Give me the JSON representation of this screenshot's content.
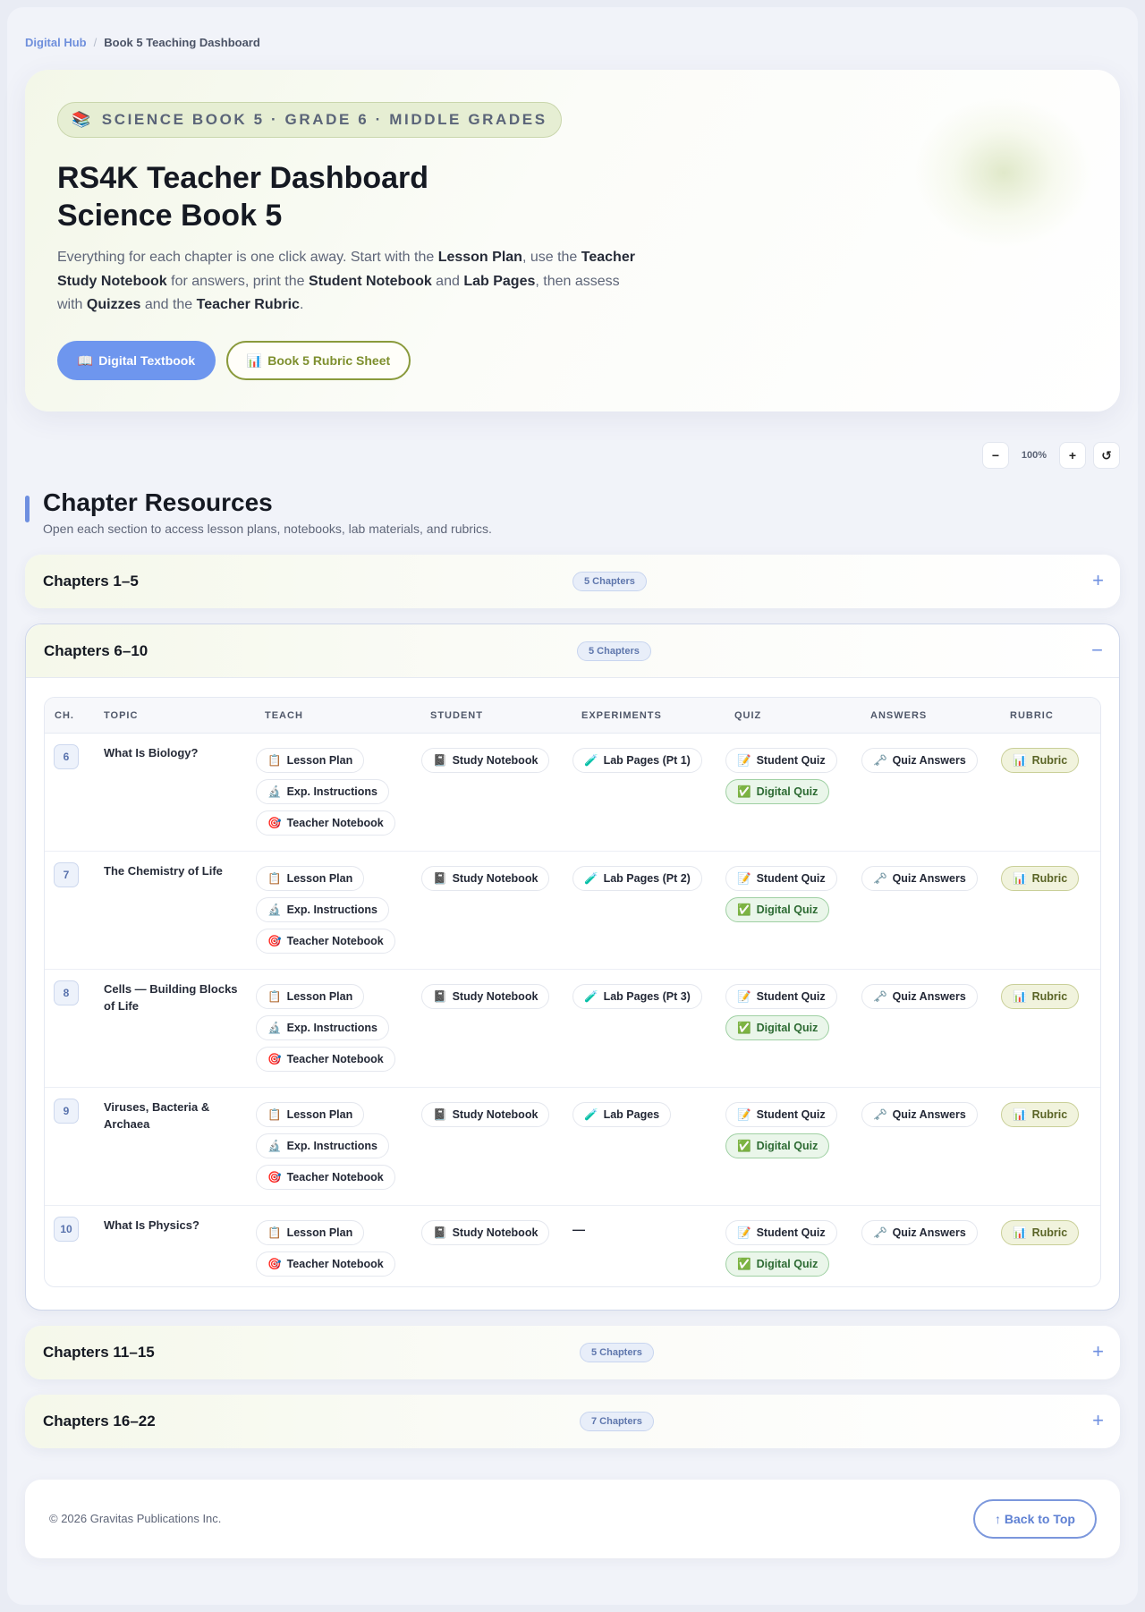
{
  "breadcrumb": {
    "root": "Digital Hub",
    "separator": "/",
    "current": "Book 5 Teaching Dashboard"
  },
  "hero": {
    "badge_icon": "📚",
    "badge": "SCIENCE BOOK 5 · GRADE 6 · MIDDLE GRADES",
    "title_line1": "RS4K Teacher Dashboard",
    "title_line2": "Science Book 5",
    "desc": {
      "t1": "Everything for each chapter is one click away. Start with the ",
      "b1": "Lesson Plan",
      "t2": ", use the ",
      "b2": "Teacher Study Notebook",
      "t3": " for answers, print the ",
      "b3": "Student Notebook",
      "t4": " and ",
      "b4": "Lab Pages",
      "t5": ", then assess with ",
      "b5": "Quizzes",
      "t6": " and the ",
      "b6": "Teacher Rubric",
      "t7": "."
    },
    "primary_button": {
      "icon": "📖",
      "label": "Digital Textbook"
    },
    "secondary_button": {
      "icon": "📊",
      "label": "Book 5 Rubric Sheet"
    }
  },
  "zoom": {
    "minus": "−",
    "level": "100%",
    "plus": "+",
    "reset": "↺"
  },
  "section": {
    "title": "Chapter Resources",
    "subtitle": "Open each section to access lesson plans, notebooks, lab materials, and rubrics."
  },
  "accordions": [
    {
      "title": "Chapters 1–5",
      "count": "5 Chapters",
      "toggle": "+"
    },
    {
      "title": "Chapters 6–10",
      "count": "5 Chapters",
      "toggle": "−"
    },
    {
      "title": "Chapters 11–15",
      "count": "5 Chapters",
      "toggle": "+"
    },
    {
      "title": "Chapters 16–22",
      "count": "7 Chapters",
      "toggle": "+"
    }
  ],
  "table": {
    "headers": [
      "CH.",
      "TOPIC",
      "TEACH",
      "STUDENT",
      "EXPERIMENTS",
      "QUIZ",
      "ANSWERS",
      "RUBRIC"
    ],
    "chip_icons": {
      "lesson_plan": "📋",
      "exp_instructions": "🔬",
      "teacher_notebook": "🎯",
      "study_notebook": "📓",
      "lab_pages": "🧪",
      "student_quiz": "📝",
      "digital_quiz": "✅",
      "quiz_answers": "🗝️",
      "rubric": "📊"
    },
    "rows": [
      {
        "ch": "6",
        "topic": "What Is Biology?",
        "teach": [
          "Lesson Plan",
          "Exp. Instructions",
          "Teacher Notebook"
        ],
        "student": "Study Notebook",
        "experiments": "Lab Pages (Pt 1)",
        "quiz": [
          "Student Quiz",
          "Digital Quiz"
        ],
        "answers": "Quiz Answers",
        "rubric": "Rubric"
      },
      {
        "ch": "7",
        "topic": "The Chemistry of Life",
        "teach": [
          "Lesson Plan",
          "Exp. Instructions",
          "Teacher Notebook"
        ],
        "student": "Study Notebook",
        "experiments": "Lab Pages (Pt 2)",
        "quiz": [
          "Student Quiz",
          "Digital Quiz"
        ],
        "answers": "Quiz Answers",
        "rubric": "Rubric"
      },
      {
        "ch": "8",
        "topic": "Cells — Building Blocks of Life",
        "teach": [
          "Lesson Plan",
          "Exp. Instructions",
          "Teacher Notebook"
        ],
        "student": "Study Notebook",
        "experiments": "Lab Pages (Pt 3)",
        "quiz": [
          "Student Quiz",
          "Digital Quiz"
        ],
        "answers": "Quiz Answers",
        "rubric": "Rubric"
      },
      {
        "ch": "9",
        "topic": "Viruses, Bacteria & Archaea",
        "teach": [
          "Lesson Plan",
          "Exp. Instructions",
          "Teacher Notebook"
        ],
        "student": "Study Notebook",
        "experiments": "Lab Pages",
        "quiz": [
          "Student Quiz",
          "Digital Quiz"
        ],
        "answers": "Quiz Answers",
        "rubric": "Rubric"
      },
      {
        "ch": "10",
        "topic": "What Is Physics?",
        "teach": [
          "Lesson Plan",
          "Teacher Notebook"
        ],
        "student": "Study Notebook",
        "experiments": "—",
        "quiz": [
          "Student Quiz",
          "Digital Quiz"
        ],
        "answers": "Quiz Answers",
        "rubric": "Rubric"
      }
    ]
  },
  "footer": {
    "copyright": "© 2026 Gravitas Publications Inc.",
    "back_to_top": "↑ Back to Top"
  }
}
